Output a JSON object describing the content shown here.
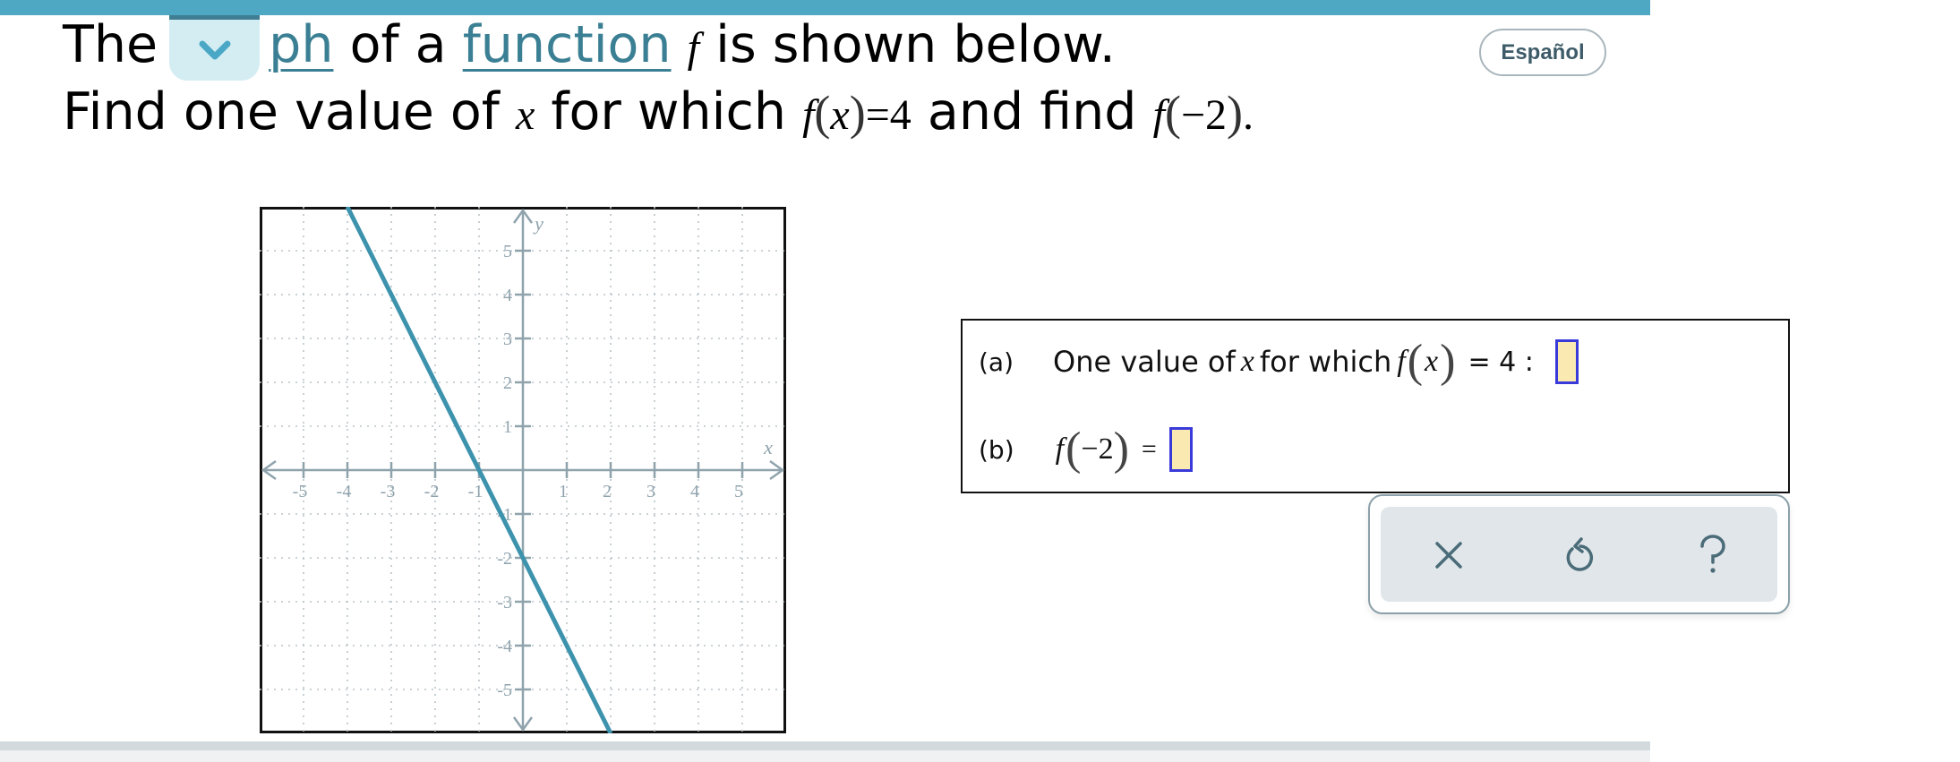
{
  "header": {
    "dropdown_icon": "chevron-down-icon",
    "line1": {
      "w1": "The",
      "link_graph_visible": "ph",
      "w2": "of a",
      "link_function": "function",
      "var_f": "f",
      "w3": "is shown below."
    },
    "line2": {
      "w1": "Find one value of",
      "var_x": "x",
      "w2": "for which",
      "expr1_f": "f",
      "expr1_x": "x",
      "expr1_rest": "=4",
      "w3": "and find",
      "expr2_f": "f",
      "expr2_arg": "−2",
      "period": "."
    },
    "language_button": "Español"
  },
  "colors": {
    "accent": "#4fa8c3",
    "link": "#3a7f93",
    "line": "#3d93ad",
    "axis": "#8fa3ad",
    "input_fill": "#faeab2",
    "input_border": "#3a3adb",
    "icon": "#4a6b78"
  },
  "chart_data": {
    "type": "line",
    "title": "",
    "xlabel": "x",
    "ylabel": "y",
    "xlim": [
      -6,
      6
    ],
    "ylim": [
      -6,
      6
    ],
    "grid": true,
    "x_ticks": [
      -5,
      -4,
      -3,
      -2,
      -1,
      1,
      2,
      3,
      4,
      5
    ],
    "y_ticks": [
      -5,
      -4,
      -3,
      -2,
      -1,
      1,
      2,
      3,
      4,
      5
    ],
    "x_tick_labels": [
      "-5",
      "-4",
      "-3",
      "-2",
      "-1",
      "1",
      "2",
      "3",
      "4",
      "5"
    ],
    "y_tick_labels": [
      "-5",
      "-4",
      "-3",
      "-2",
      "-1",
      "1",
      "2",
      "3",
      "4",
      "5"
    ],
    "series": [
      {
        "name": "f",
        "x": [
          -4,
          2
        ],
        "y": [
          6,
          -6
        ],
        "equation": "y = -2x - 2"
      }
    ]
  },
  "answers": {
    "a": {
      "label": "(a)",
      "text": "One value of",
      "var": "x",
      "text2": "for which",
      "f": "f",
      "arg": "x",
      "eq": "= 4 :",
      "value": ""
    },
    "b": {
      "label": "(b)",
      "f": "f",
      "arg": "−2",
      "eq": "=",
      "value": ""
    }
  },
  "toolbar": {
    "clear_icon": "close-icon",
    "undo_icon": "undo-icon",
    "help_icon": "help-icon"
  }
}
